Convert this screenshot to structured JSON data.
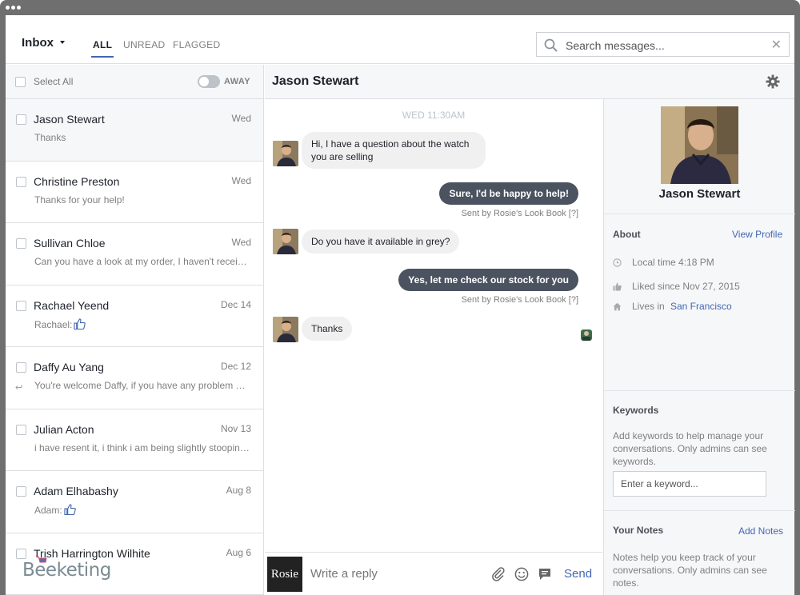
{
  "inbox": {
    "label": "Inbox"
  },
  "filters": [
    {
      "label": "ALL",
      "active": true
    },
    {
      "label": "UNREAD",
      "active": false
    },
    {
      "label": "FLAGGED",
      "active": false
    }
  ],
  "search": {
    "placeholder": "Search messages..."
  },
  "list_header": {
    "select_all": "Select All",
    "status_label": "AWAY",
    "away_toggle_on": false
  },
  "conversations": [
    {
      "name": "Jason Stewart",
      "date": "Wed",
      "preview": "Thanks",
      "selected": true
    },
    {
      "name": "Christine Preston",
      "date": "Wed",
      "preview": "Thanks for your help!"
    },
    {
      "name": "Sullivan Chloe",
      "date": "Wed",
      "preview": "Can you have a look at my order, I haven't received it yet"
    },
    {
      "name": "Rachael Yeend",
      "date": "Dec 14",
      "preview": "Rachael:",
      "preview_icon": "thumbs-up-icon"
    },
    {
      "name": "Daffy Au Yang",
      "date": "Dec 12",
      "preview": "You're welcome Daffy, if you have any problem please let us know",
      "replied": true
    },
    {
      "name": "Julian Acton",
      "date": "Nov 13",
      "preview": "i have resent it, i think i am being slightly stooping here"
    },
    {
      "name": "Adam Elhabashy",
      "date": "Aug 8",
      "preview": "Adam:",
      "preview_icon": "thumbs-up-icon"
    },
    {
      "name": "Trish Harrington Wilhite",
      "date": "Aug 6",
      "preview": ""
    }
  ],
  "brand": {
    "name": "Beeketing"
  },
  "chat": {
    "title": "Jason Stewart",
    "timestamp": "WED 11:30AM",
    "messages": [
      {
        "dir": "in",
        "text": "Hi, I have a question about the watch you are selling"
      },
      {
        "dir": "out",
        "text": "Sure, I'd be happy to help!",
        "sent_by": "Sent by Rosie's Look Book [?]"
      },
      {
        "dir": "in",
        "text": "Do you have it available in grey?"
      },
      {
        "dir": "out",
        "text": "Yes, let me check our stock for you",
        "sent_by": "Sent by Rosie's Look Book [?]"
      },
      {
        "dir": "in",
        "text": "Thanks"
      }
    ],
    "compose": {
      "page_avatar_text": "Rosie",
      "placeholder": "Write a reply",
      "send_label": "Send"
    }
  },
  "profile": {
    "name": "Jason Stewart",
    "about_title": "About",
    "view_profile": "View Profile",
    "local_time": "Local time 4:18 PM",
    "liked_since": "Liked since Nov 27, 2015",
    "lives_in_label": "Lives in",
    "lives_in_city": "San Francisco",
    "keywords_title": "Keywords",
    "keywords_desc": "Add keywords to help manage your conversations. Only admins can see keywords.",
    "keyword_placeholder": "Enter a keyword...",
    "notes_title": "Your Notes",
    "add_notes": "Add Notes",
    "notes_desc": "Notes help you keep track of your conversations. Only admins can see notes."
  },
  "colors": {
    "accent": "#4267b2",
    "outgoing_bubble": "#4b5361",
    "incoming_bubble": "#f1f0f0",
    "panel_bg": "#f6f7f9"
  }
}
